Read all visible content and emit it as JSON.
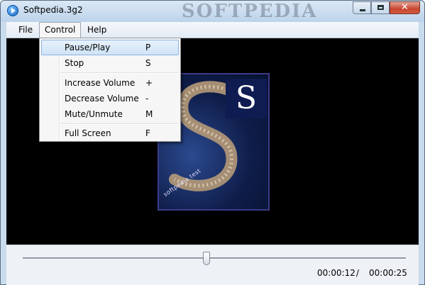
{
  "window": {
    "title": "Softpedia.3g2",
    "watermark": "SOFTPEDIA",
    "close_glyph": "✕"
  },
  "menubar": {
    "items": [
      {
        "label": "File"
      },
      {
        "label": "Control"
      },
      {
        "label": "Help"
      }
    ],
    "open_menu": "Control"
  },
  "control_menu": {
    "items": [
      {
        "label": "Pause/Play",
        "shortcut": "P",
        "highlighted": true
      },
      {
        "label": "Stop",
        "shortcut": "S"
      },
      {
        "label": "Increase Volume",
        "shortcut": "+"
      },
      {
        "label": "Decrease Volume",
        "shortcut": "-"
      },
      {
        "label": "Mute/Unmute",
        "shortcut": "M"
      },
      {
        "label": "Full Screen",
        "shortcut": "F"
      }
    ]
  },
  "video": {
    "poster_logo_letter": "S",
    "poster_caption": "softpedia test"
  },
  "playback": {
    "current_time": "00:00:12",
    "separator": "/",
    "total_time": "00:00:25",
    "progress_fraction": 0.48
  },
  "colors": {
    "video_background": "#000000",
    "highlight_border": "#8db2e3",
    "close_button": "#c6462e"
  },
  "icons": {
    "app": "play-circle-icon",
    "minimize": "minimize-icon",
    "maximize": "maximize-icon",
    "close": "close-icon"
  }
}
